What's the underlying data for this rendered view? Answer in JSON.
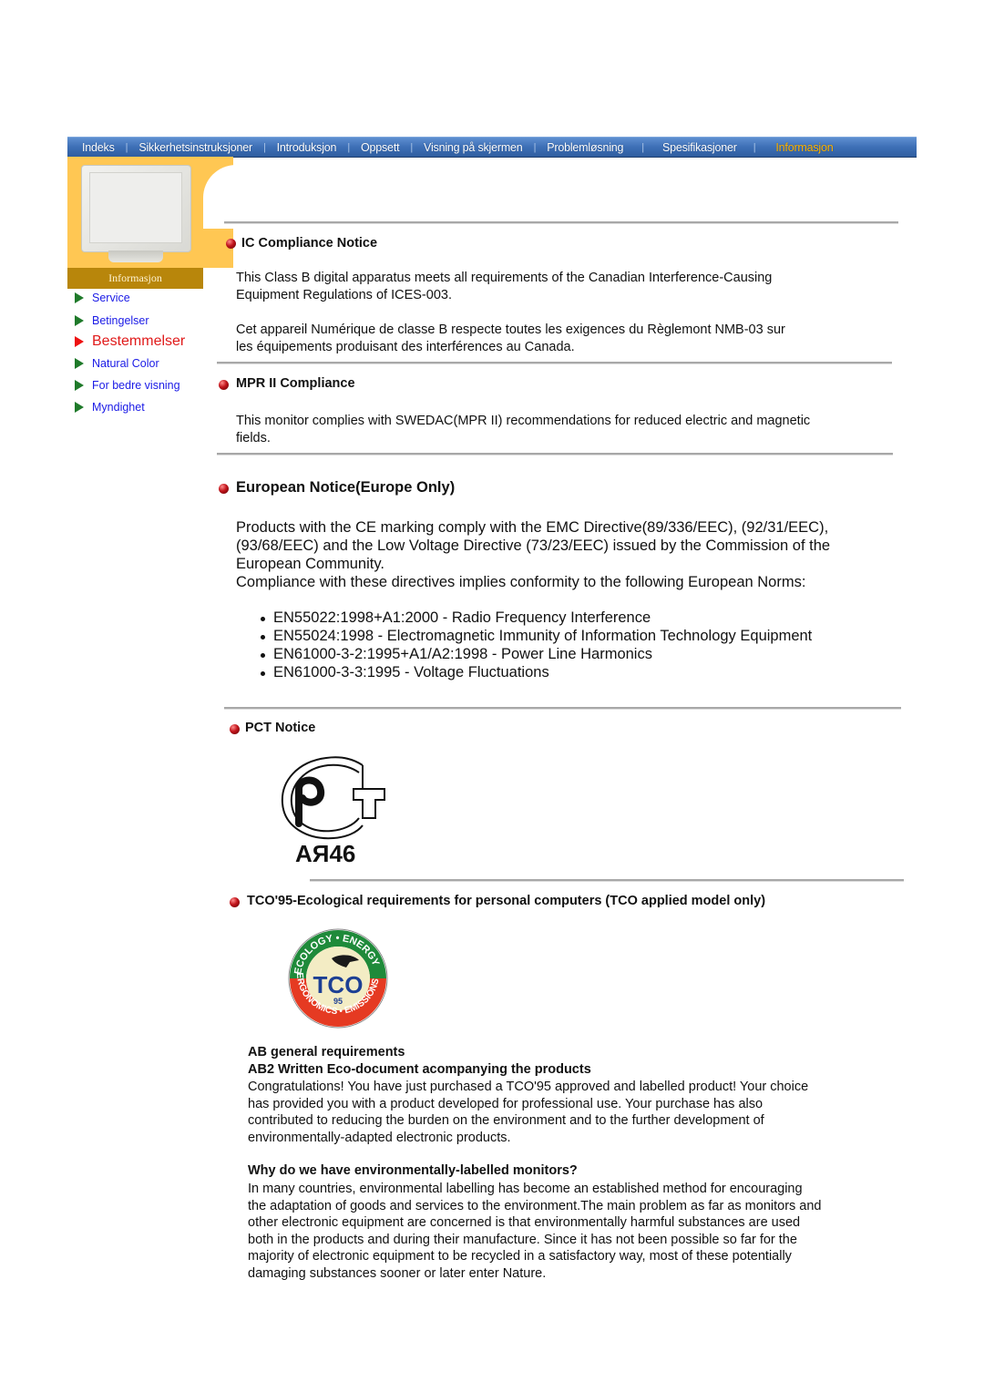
{
  "nav": {
    "items": [
      {
        "label": "Indeks",
        "active": false
      },
      {
        "label": "Sikkerhetsinstruksjoner",
        "active": false
      },
      {
        "label": "Introduksjon",
        "active": false
      },
      {
        "label": "Oppsett",
        "active": false
      },
      {
        "label": "Visning på skjermen",
        "active": false
      },
      {
        "label": "Problemløsning",
        "active": false
      },
      {
        "label": "Spesifikasjoner",
        "active": false
      },
      {
        "label": "Informasjon",
        "active": true
      }
    ],
    "separator": "|"
  },
  "left_panel": {
    "image_icon": "monitor-image",
    "section_label": "Informasjon"
  },
  "sidebar": {
    "items": [
      {
        "label": "Service",
        "active": false
      },
      {
        "label": "Betingelser",
        "active": false
      },
      {
        "label": "Bestemmelser",
        "active": true
      },
      {
        "label": "Natural Color",
        "active": false
      },
      {
        "label": "For bedre visning",
        "active": false
      },
      {
        "label": "Myndighet",
        "active": false
      }
    ],
    "colors": {
      "link": "#1a1ae6",
      "active": "#e01a1a",
      "arrow": "#1f7a2a",
      "active_arrow": "#ee1111"
    }
  },
  "sections": {
    "ic": {
      "title": "IC Compliance Notice",
      "en_lines": [
        "This Class B digital apparatus meets all requirements of the Canadian Interference-Causing",
        "Equipment Regulations of ICES-003."
      ],
      "fr_lines": [
        "Cet appareil Numérique de classe B respecte toutes les exigences du Règlemont NMB-03 sur",
        "les équipements produisant des interférences au Canada."
      ]
    },
    "mpr": {
      "title": "MPR II Compliance",
      "lines": [
        "This monitor complies with SWEDAC(MPR II) recommendations for reduced electric and magnetic",
        "fields."
      ]
    },
    "europe": {
      "title": "European Notice(Europe Only)",
      "lines": [
        "Products with the CE marking comply with the EMC Directive(89/336/EEC), (92/31/EEC),",
        "(93/68/EEC) and the Low Voltage Directive (73/23/EEC) issued by the Commission of the",
        "European Community.",
        "Compliance with these directives implies conformity to the following European Norms:"
      ],
      "norms": [
        "EN55022:1998+A1:2000 - Radio Frequency Interference",
        "EN55024:1998 - Electromagnetic Immunity of Information Technology Equipment",
        "EN61000-3-2:1995+A1/A2:1998 - Power Line Harmonics",
        "EN61000-3-3:1995 - Voltage Fluctuations"
      ]
    },
    "pct": {
      "title": "PCT Notice",
      "logo_icon": "pct-certification-logo",
      "logo_code": "АЯ46"
    },
    "tco": {
      "title": "TCO'95-Ecological requirements for personal computers (TCO applied model only)",
      "logo_icon": "tco95-ecology-logo",
      "logo_text": {
        "top": "ECOLOGY • ENERGY",
        "bottom": "ERGONOMICS • EMISSIONS",
        "center": "TCO",
        "year": "95"
      },
      "sub1": "AB general requirements",
      "sub2": "AB2 Written Eco-document acompanying the products",
      "para1": [
        "Congratulations! You have just purchased a TCO'95 approved and labelled product! Your choice",
        "has provided you with a product developed for professional use. Your purchase has also",
        "contributed to reducing the burden on the environment and to the further development of",
        "environmentally-adapted electronic products."
      ],
      "sub3": "Why do we have environmentally-labelled monitors?",
      "para2": [
        "In many countries, environmental labelling has become an established method for encouraging",
        "the adaptation of goods and services to the environment.The main problem as far as monitors and",
        "other electronic equipment are concerned is that environmentally harmful substances are used",
        "both in the products and during their manufacture. Since it has not been possible so far for the",
        "majority of electronic equipment to be recycled in a satisfactory way, most of these potentially",
        "damaging substances sooner or later enter Nature."
      ]
    }
  }
}
